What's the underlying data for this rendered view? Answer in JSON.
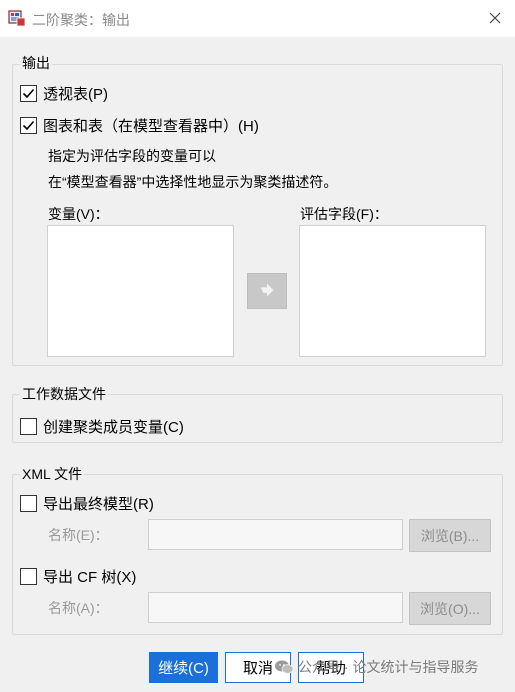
{
  "window": {
    "title": "二阶聚类：输出"
  },
  "output_group": {
    "title": "输出",
    "pivot_table": {
      "label": "透视表(P)",
      "checked": true
    },
    "charts_tables": {
      "label": "图表和表（在模型查看器中）(H)",
      "checked": true
    },
    "hint_line1": "指定为评估字段的变量可以",
    "hint_line2": "在“模型查看器”中选择性地显示为聚类描述符。",
    "variables_label": "变量(V)：",
    "eval_fields_label": "评估字段(F)："
  },
  "working_data_group": {
    "title": "工作数据文件",
    "create_membership": {
      "label": "创建聚类成员变量(C)",
      "checked": false
    }
  },
  "xml_group": {
    "title": "XML 文件",
    "export_final": {
      "label": "导出最终模型(R)",
      "checked": false
    },
    "name1_label": "名称(E)：",
    "name1_value": "",
    "browse1_label": "浏览(B)...",
    "export_cf": {
      "label": "导出 CF 树(X)",
      "checked": false
    },
    "name2_label": "名称(A)：",
    "name2_value": "",
    "browse2_label": "浏览(O)..."
  },
  "buttons": {
    "continue": "继续(C)",
    "cancel": "取消",
    "help": "帮助"
  },
  "watermark": {
    "text": "公众号 · 论文统计与指导服务"
  },
  "colors": {
    "accent": "#1a6fd8",
    "background": "#f0f0f0"
  }
}
